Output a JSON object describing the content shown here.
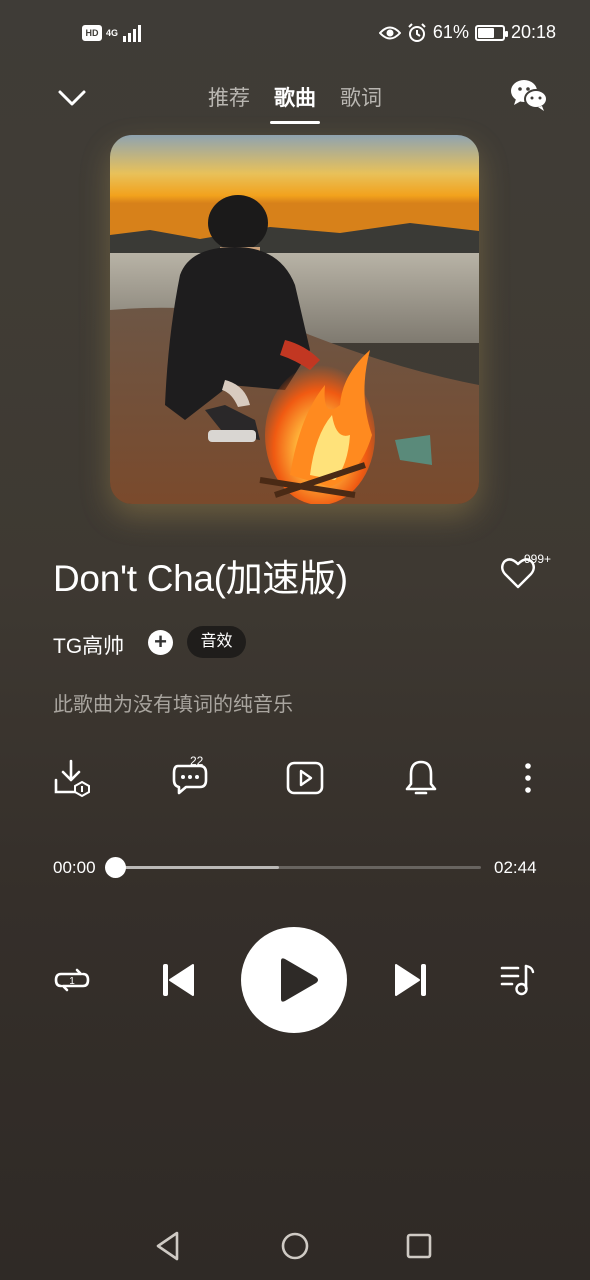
{
  "status_bar": {
    "hd": "HD",
    "network": "4G",
    "battery_percent": "61%",
    "battery_level": 0.61,
    "time": "20:18"
  },
  "header": {
    "tabs": [
      {
        "label": "推荐",
        "active": false
      },
      {
        "label": "歌曲",
        "active": true
      },
      {
        "label": "歌词",
        "active": false
      }
    ]
  },
  "song": {
    "title": "Don't Cha(加速版)",
    "likes": "999+",
    "artist": "TG高帅",
    "effect_label": "音效",
    "description": "此歌曲为没有填词的纯音乐"
  },
  "actions": {
    "comment_count": "22",
    "icons": [
      "download-icon",
      "comment-icon",
      "video-icon",
      "bell-icon",
      "more-icon"
    ]
  },
  "player": {
    "current_time": "00:00",
    "duration": "02:44",
    "progress": 0.0,
    "buffered": 0.45,
    "repeat_badge": "1"
  },
  "colors": {
    "background": "#3e3a34",
    "accent": "#ffffff",
    "muted_text": "#a9a59f"
  }
}
